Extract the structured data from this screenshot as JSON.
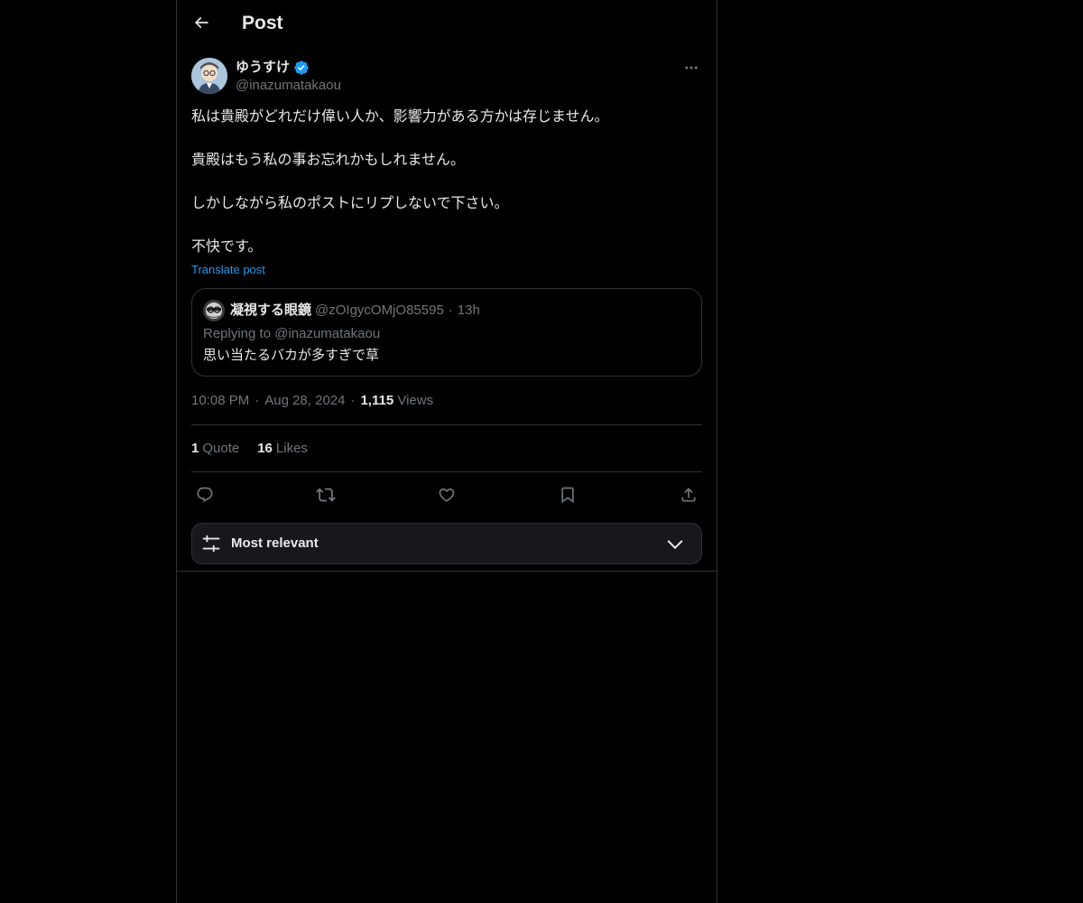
{
  "header": {
    "title": "Post",
    "back_icon": "arrow-left-icon"
  },
  "post": {
    "author": {
      "display_name": "ゆうすけ",
      "handle": "@inazumatakaou",
      "verified": true,
      "verified_color": "#1d9bf0"
    },
    "paragraphs": [
      "私は貴殿がどれだけ偉い人か、影響力がある方かは存じません。",
      "貴殿はもう私の事お忘れかもしれません。",
      "しかしながら私のポストにリプしないで下さい。",
      "不快です。"
    ],
    "translate_label": "Translate post",
    "quote": {
      "display_name": "凝視する眼鏡",
      "handle": "@zOIgycOMjO85595",
      "separator": "·",
      "time": "13h",
      "replying_to": "Replying to @inazumatakaou",
      "text": "思い当たるバカが多すぎで草"
    },
    "time": "10:08 PM",
    "date": "Aug 28, 2024",
    "separator": "·",
    "views_count": "1,115",
    "views_label": "Views",
    "stats": {
      "quotes_count": "1",
      "quotes_label": "Quote",
      "likes_count": "16",
      "likes_label": "Likes"
    },
    "actions": [
      "reply-icon",
      "repost-icon",
      "like-icon",
      "bookmark-icon",
      "share-icon"
    ]
  },
  "replies_sort": {
    "label": "Most relevant",
    "icon": "sliders-icon",
    "chevron": "chevron-down-icon"
  },
  "colors": {
    "background": "#000000",
    "text": "#e7e9ea",
    "muted": "#71767b",
    "accent": "#1d9bf0",
    "border": "#2f3336"
  }
}
